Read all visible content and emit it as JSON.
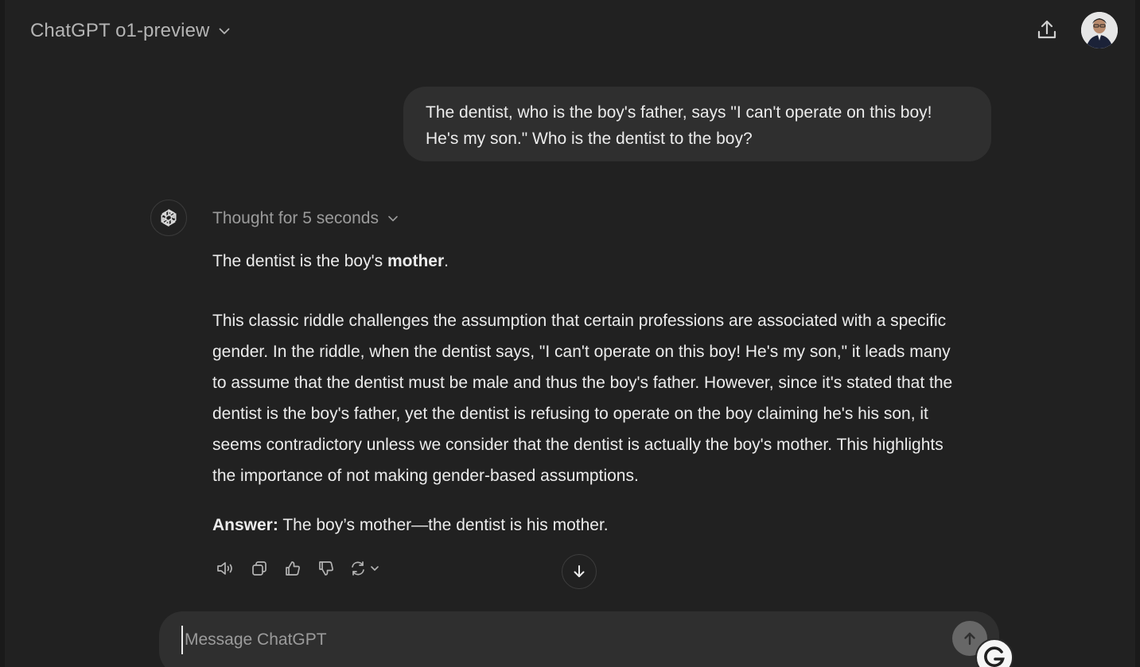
{
  "header": {
    "model_name": "ChatGPT o1-preview",
    "model_switch_icon": "chevron-down-icon",
    "share_icon": "share-upload-icon",
    "avatar_icon": "user-avatar"
  },
  "conversation": {
    "user_message": {
      "line1": "The dentist, who is the boy's father, says \"I can't operate on this boy!",
      "line2": "He's my son.\" Who is the dentist to the boy?"
    },
    "assistant": {
      "avatar_icon": "openai-logo-icon",
      "thought_label": "Thought for 5 seconds",
      "intro_prefix": "The dentist is the boy's ",
      "intro_bold": "mother",
      "intro_suffix": ".",
      "explanation": [
        "This classic riddle challenges the assumption that certain professions are associated with a specific",
        "gender. In the riddle, when the dentist says, \"I can't operate on this boy! He's my son,\" it leads many",
        "to assume that the dentist must be male and thus the boy's father. However, since it's stated that the",
        "dentist is the boy's father, yet the dentist is refusing to operate on the boy claiming he's his son, it",
        "seems contradictory unless we consider that the dentist is actually the boy's mother. This highlights",
        "the importance of not making gender-based assumptions."
      ],
      "answer_label": "Answer:",
      "answer_text": " The boy’s mother—the dentist is his mother."
    },
    "actions": [
      {
        "name": "read-aloud-button",
        "icon": "speaker-icon"
      },
      {
        "name": "copy-button",
        "icon": "copy-icon"
      },
      {
        "name": "thumbs-up-button",
        "icon": "thumbs-up-icon"
      },
      {
        "name": "thumbs-down-button",
        "icon": "thumbs-down-icon"
      },
      {
        "name": "regenerate-button",
        "icon": "refresh-icon"
      }
    ]
  },
  "composer": {
    "placeholder": "Message ChatGPT",
    "value": "",
    "send_icon": "arrow-up-icon"
  },
  "grammarly": {
    "letter": "G"
  },
  "colors": {
    "background": "#212121",
    "bubble": "#2f2f2f",
    "text": "#ececec",
    "muted": "#9b9b9b"
  }
}
